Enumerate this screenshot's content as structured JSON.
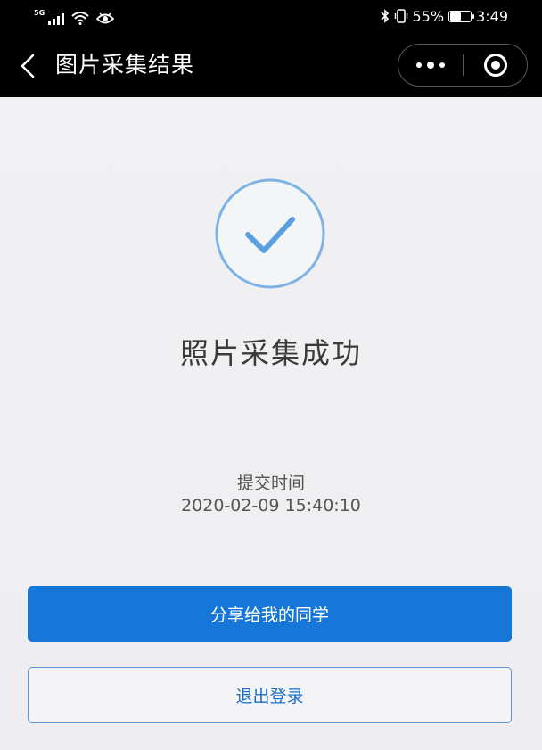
{
  "status_bar": {
    "network": "5G",
    "battery": "55%",
    "battery_level": 0.55,
    "time": "3:49",
    "icons": [
      "signal-icon",
      "wifi-icon",
      "eye-icon",
      "bluetooth-icon",
      "vibrate-icon",
      "battery-icon"
    ]
  },
  "nav": {
    "title": "图片采集结果",
    "icons": [
      "back-chevron-icon",
      "more-dots-icon",
      "close-target-icon"
    ]
  },
  "result": {
    "icon": "checkmark-circle-icon",
    "title": "照片采集成功",
    "submit_label": "提交时间",
    "submit_time": "2020-02-09 15:40:10"
  },
  "actions": {
    "share_label": "分享给我的同学",
    "logout_label": "退出登录"
  },
  "colors": {
    "primary": "#1677d8",
    "check": "#5a9fe0",
    "background": "#f0f0f2"
  }
}
